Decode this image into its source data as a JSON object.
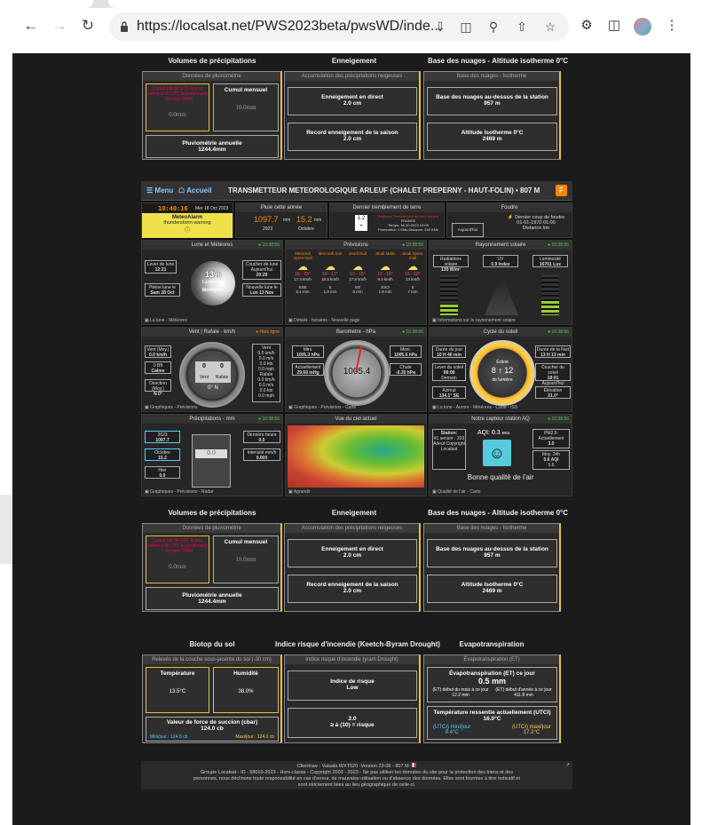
{
  "browser": {
    "url": "https://localsat.net/PWS2023beta/pwsWD/inde...",
    "back_icon": "arrow-left",
    "forward_icon": "arrow-right",
    "reload_icon": "reload"
  },
  "precip_top": {
    "section_volumes": "Volumes de précipitations",
    "section_snow": "Enneigement",
    "section_clouds": "Base des nuages - Altitude isotherme 0°C",
    "rain_head": "Données de pluviométrie",
    "rain_day_label": "Cumul (de 6h UTC le jour même à 6h UTC le lendemain) - Normes OMM",
    "rain_day_value": "0.0mm",
    "rain_month_label": "Cumul mensuel",
    "rain_month_value": "10.0mm",
    "rain_year_label": "Pluviométrie annuelle",
    "rain_year_value": "1244.4mm",
    "snow_head": "Accumulation des précipitations neigeuses",
    "snow_live_label": "Enneigement en direct",
    "snow_live_value": "2.0 cm",
    "snow_record_label": "Record enneigement de la saison",
    "snow_record_value": "2.0 cm",
    "cloud_head": "Base des nuages - Isotherme",
    "cloud_base_label": "Base des nuages au-dessus de la station",
    "cloud_base_value": "957 m",
    "iso_label": "Altitude Isotherme 0°C",
    "iso_value": "2469 m"
  },
  "dash": {
    "menu": "Menu",
    "home": "Accueil",
    "title": "TRANSMETTEUR METEOROLOGIQUE ARLEUF (CHALET PREPERNY - HAUT-FOLIN)  •  807 M",
    "time": "10:40:16",
    "date": "Mer 18 Oct 2023",
    "meteoalarm_title": "MeteoAlarm",
    "meteoalarm_text": "thunderstorm warning",
    "rain_year_head": "Pluie cette année",
    "rain_year_val": "1097.7",
    "rain_year_unit": "mm",
    "rain_year_sub": "2023",
    "rain_oct_val": "15.2",
    "rain_oct_unit": "mm",
    "rain_oct_sub": "Octobre",
    "quake_head": "Dernier tremblement de terre",
    "quake_mag": "1.2",
    "quake_text": "Régional Tremblement de terre mineur",
    "quake_country": "FRANCE",
    "quake_time": "Temps: 18-10-2023 10:09",
    "quake_depth": "Profondeur: 1 KMs Distance: 240 KMs",
    "storm_head": "Foudre",
    "storm_text1": "Dernier coup de foudre",
    "storm_text2": "01-01-1970 01:00",
    "storm_text3": "Distance km",
    "storm_today": "Aujourd'hui",
    "moon_head": "Lune et Météores",
    "moon_rise_label": "Lever de lune",
    "moon_rise": "12:21",
    "moon_set_label": "Coucher de lune Aujourd'hui",
    "moon_set": "20:29",
    "moon_full_label": "Pleine lune le",
    "moon_full": "Sam 28 Oct",
    "moon_new_label": "Nouvelle lune le",
    "moon_new": "Lun 13 Nov",
    "moon_pct": "13%",
    "moon_lum": "Luminance",
    "moon_phase": "Montante",
    "moon_footer": "La lune - Météores",
    "ts": "10:38:56",
    "fc_head": "Prévisions",
    "fc_footer": "Détails - horaires - Nouvelle page",
    "forecast": [
      {
        "day": "Mercredi Après-midi",
        "temp": "18 - 23°",
        "pr": "17.3 km/h",
        "dir": "SSE",
        "rain": "5.1 mm"
      },
      {
        "day": "Mercredi Soir",
        "temp": "16 - 17°",
        "pr": "16.5 km/h",
        "dir": "S",
        "rain": "1.9 mm"
      },
      {
        "day": "Jeudi Nuit",
        "temp": "13 - 15°",
        "pr": "17.8 km/h",
        "dir": "SO",
        "rain": "0 mm"
      },
      {
        "day": "Jeudi Matin",
        "temp": "12 - 16°",
        "pr": "9.4 km/h",
        "dir": "SSO",
        "rain": "1.8 mm"
      },
      {
        "day": "Jeudi Après-midi",
        "temp": "16 - 18°",
        "pr": "14 km/h",
        "dir": "S",
        "rain": "7 mm"
      }
    ],
    "solar_head": "Rayonnement solaire",
    "solar_rad_label": "Radiations solaire",
    "solar_rad": "130 W/m²",
    "uv_label": "UV",
    "uv": "0.9 Index",
    "lum_label": "Luminosité",
    "lum": "16701 Lux",
    "solar_footer": "Informations sur le rayonnement solaire",
    "wind_head": "Vent | Rafale - km/h",
    "wind_ts": "Hors ligne",
    "wind_moy_label": "Vent (Moy.)",
    "wind_moy": "0.0 km/h",
    "wind_bft": "0 Bft",
    "wind_calme": "Calme",
    "wind_dir_label": "Direction (Moy.)",
    "wind_dir": "N 0°",
    "wind_max": "0 km/h",
    "wind_gauge": "0",
    "wind_gauge2": "0",
    "wind_dirdeg": "0° N",
    "wind_list": [
      "Vent",
      "0.0 km/h",
      "0.0 m/s",
      "0.0 kts",
      "0.0 mph",
      "Rafale",
      "0.0 km/h",
      "0.0 m/s",
      "0.0 kts",
      "0.0 mph"
    ],
    "wind_footer": "Graphiques - Prévisions",
    "baro_head": "Barometre - hPa",
    "baro_min_label": "Mini.",
    "baro_min": "1005.3 hPa",
    "baro_max_label": "Maxi.",
    "baro_max": "1005.6 hPa",
    "baro_now_label": "Actuellement",
    "baro_now": "29.69 inHg",
    "baro_trend_label": "Chute",
    "baro_trend": "-0.20 hPa",
    "baro_value": "1005.4",
    "baro_footer": "Graphiques - Prévisions - Carte",
    "sun_head": "Cycle du soleil",
    "sun_day_label": "Durée du jour",
    "sun_day": "10 H 46 min",
    "sun_night_label": "Durée de la Nuit",
    "sun_night": "13 H 13 min",
    "sun_rise_label": "Lever du soleil",
    "sun_rise": "08:08",
    "sun_rise_when": "Demain",
    "sun_set_label": "Coucher du soleil",
    "sun_set": "18:01",
    "sun_set_when": "Aujourd'hui",
    "sun_az_label": "Azimut",
    "sun_az": "134.1° SE",
    "sun_el_label": "Élévation",
    "sun_el": "21.0°",
    "sun_center1": "Écliné",
    "sun_center2": "8 ↑ 12",
    "sun_center3": "de lumière",
    "sun_footer": "La lune - Aurore - Météores - Carte - ISS",
    "pm_head": "Précipitations - mm",
    "pm_year": "2023",
    "pm_year_val": "1097.7",
    "pm_oct": "Octobre",
    "pm_oct_val": "15.2",
    "pm_yest": "Hier",
    "pm_yest_val": "0.0",
    "pm_gauge": "0.0",
    "pm_last_label": "Dernière heure",
    "pm_last": "0.0",
    "pm_int_label": "Intensité mm/h",
    "pm_int": "0.000",
    "pm_footer": "Graphiques - Prévisions - Radar",
    "sky_head": "Vue du ciel actuel",
    "sky_footer": "Agrandir",
    "aq_head": "Notre capteur station AQ",
    "aq_station": "Station:",
    "aq_station_val": "#1 sensor : 203 Arleuf Copyright Localsat",
    "aq_index": "AQI: 0.3",
    "aq_unit": "eea",
    "aq_pm25_label": "PM2.5: Actuellement",
    "aq_pm25": "3.0",
    "aq_24h_label": "Moy. 24h",
    "aq_24h": "5.6 AQI",
    "aq_24h2": "5.6",
    "aq_good": "Bonne qualité de l'air",
    "aq_footer": "Qualité de l'air - Carte"
  },
  "precip_bottom": {
    "section_volumes": "Volumes de précipitations",
    "section_snow": "Enneigement",
    "section_clouds": "Base des nuages - Altitude isotherme 0°C",
    "rain_head": "Données de pluviométrie",
    "rain_day_label": "Cumul (de 6h UTC le jour même à 6h UTC le lendemain) - Normes OMM",
    "rain_day_value": "0.0mm",
    "rain_month_label": "Cumul mensuel",
    "rain_month_value": "10.0mm",
    "rain_year_label": "Pluviométrie annuelle",
    "rain_year_value": "1244.4mm",
    "snow_head": "Accumulation des précipitations neigeuses",
    "snow_live_label": "Enneigement en direct",
    "snow_live_value": "2.0 cm",
    "snow_record_label": "Record enneigement de la saison",
    "snow_record_value": "2.0 cm",
    "cloud_head": "Base des nuages - Isotherme",
    "cloud_base_label": "Base des nuages au-dessus de la station",
    "cloud_base_value": "957 m",
    "iso_label": "Altitude Isotherme 0°C",
    "iso_value": "2469 m"
  },
  "soil": {
    "section_soil": "Biotop du sol",
    "section_fire": "Indice risque d'incendie (Keetch-Byram Drought)",
    "section_evapo": "Evapotranspiration",
    "soil_head": "Relevés de la couche sous-jacente du sol (-30 cm)",
    "temp_label": "Température",
    "temp_val": "13.5°C",
    "hum_label": "Humidité",
    "hum_val": "38.0%",
    "suction_label": "Valeur de force de succion (cbar)",
    "suction_val": "124.0 cb",
    "suction_min": "Mini/jour : 124.0 cb",
    "suction_max": "Maxi/jour : 124.0 cb",
    "fire_head": "Indice risque d'incendie (yram Drought)",
    "fire_label": "Indice de risque",
    "fire_val": "Low",
    "fire_num": "2.0",
    "fire_thr": "≥ à (10) = risque",
    "evapo_head": "Évapotranspiration (ET)",
    "evapo_day_label": "Évapotranspiration (ET) ce jour",
    "evapo_day": "0.5 mm",
    "evapo_month_label": "(ET) début du mois à ce jour",
    "evapo_month": "12.2 mm",
    "evapo_year_label": "(ET) début d'année à ce jour",
    "evapo_year": "411.8 mm",
    "utci_label": "Température ressentie actuellement (UTCI)",
    "utci_val": "16.0°C",
    "utci_min_label": "(UTCI) mini/jour",
    "utci_min": "9.4°C",
    "utci_max_label": "(UTCI) maxi/jour",
    "utci_max": "17.2°C"
  },
  "footer": {
    "line1": "Clientraw  -  Vaisala WXT520 -Version 23-06  -  807 M",
    "line2": "Groupe Localsat - ID : 58010-2023 - Hors-classe - Copyright 2003 - 2023 - Ne pas utiliser les données du site pour la protection des biens et des",
    "line3": "personnes, nous déclinons toute responsabilité en cas d'erreur, de mauvaise utilisation ou d'absence des données. Elles sont fournies à titre indicatif et",
    "line4": "sont strictement liées au lieu géographique de celle-ci."
  }
}
